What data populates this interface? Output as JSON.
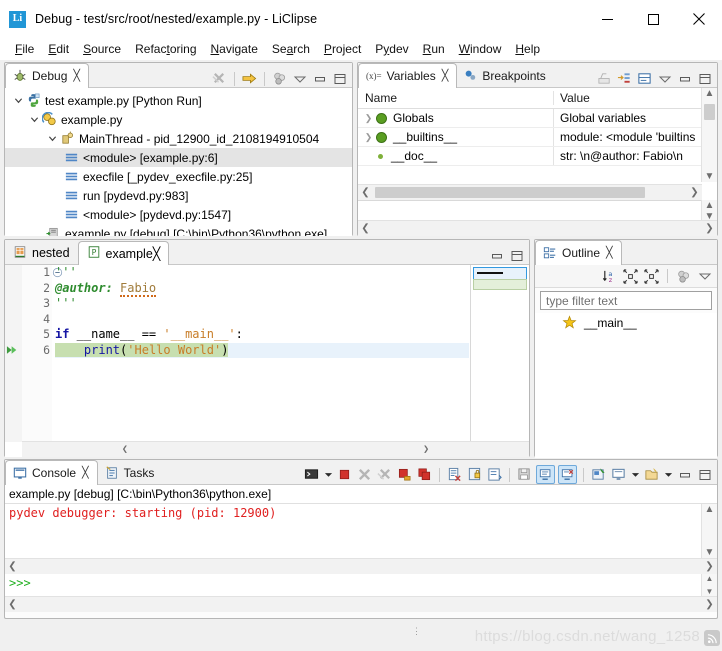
{
  "window": {
    "app_icon": "Li",
    "title": "Debug - test/src/root/nested/example.py - LiClipse",
    "minimize": "minimize-button",
    "maximize": "maximize-button",
    "close": "close-button"
  },
  "menubar": {
    "items": [
      {
        "label": "File",
        "mnemonic": "F"
      },
      {
        "label": "Edit",
        "mnemonic": "E"
      },
      {
        "label": "Source",
        "mnemonic": "S"
      },
      {
        "label": "Refactoring",
        "mnemonic": "t"
      },
      {
        "label": "Navigate",
        "mnemonic": "N"
      },
      {
        "label": "Search",
        "mnemonic": "a"
      },
      {
        "label": "Project",
        "mnemonic": "P"
      },
      {
        "label": "Pydev",
        "mnemonic": "y"
      },
      {
        "label": "Run",
        "mnemonic": "R"
      },
      {
        "label": "Window",
        "mnemonic": "W"
      },
      {
        "label": "Help",
        "mnemonic": "H"
      }
    ]
  },
  "debug_view": {
    "tab_label": "Debug",
    "toolbar": [
      {
        "name": "remove-all-terminated-icon"
      },
      {
        "name": "resume-icon"
      },
      {
        "name": "view-menu-threads-icon"
      },
      {
        "name": "view-menu-icon"
      },
      {
        "name": "minimize-icon"
      },
      {
        "name": "maximize-icon"
      }
    ],
    "tree": [
      {
        "indent": 0,
        "twisty": "expanded",
        "icon": "python-launch-icon",
        "label": "test example.py [Python Run]",
        "selected": false
      },
      {
        "indent": 1,
        "twisty": "expanded",
        "icon": "debug-target-icon",
        "label": "example.py",
        "selected": false
      },
      {
        "indent": 2,
        "twisty": "expanded",
        "icon": "thread-icon",
        "label": "MainThread - pid_12900_id_2108194910504",
        "selected": false
      },
      {
        "indent": 3,
        "twisty": "none",
        "icon": "stack-frame-icon",
        "label": "<module> [example.py:6]",
        "selected": true
      },
      {
        "indent": 3,
        "twisty": "none",
        "icon": "stack-frame-icon",
        "label": "execfile [_pydev_execfile.py:25]",
        "selected": false
      },
      {
        "indent": 3,
        "twisty": "none",
        "icon": "stack-frame-icon",
        "label": "run [pydevd.py:983]",
        "selected": false
      },
      {
        "indent": 3,
        "twisty": "none",
        "icon": "stack-frame-icon",
        "label": "<module> [pydevd.py:1547]",
        "selected": false
      },
      {
        "indent": 2,
        "twisty": "none",
        "icon": "process-icon",
        "label": "example.py [debug] [C:\\bin\\Python36\\python.exe]",
        "selected": false
      }
    ]
  },
  "variables_view": {
    "tabs": [
      {
        "label": "Variables",
        "icon": "variables-icon",
        "active": true
      },
      {
        "label": "Breakpoints",
        "icon": "breakpoints-icon",
        "active": false
      }
    ],
    "toolbar": [
      {
        "name": "show-logical-structure-icon"
      },
      {
        "name": "collapse-all-icon"
      },
      {
        "name": "show-detail-pane-icon"
      },
      {
        "name": "view-menu-icon"
      },
      {
        "name": "minimize-icon"
      },
      {
        "name": "maximize-icon"
      }
    ],
    "columns": [
      "Name",
      "Value"
    ],
    "rows": [
      {
        "expandable": true,
        "bullet": "large",
        "name": "Globals",
        "value": "Global variables"
      },
      {
        "expandable": true,
        "bullet": "large",
        "name": "__builtins__",
        "value": "module: <module 'builtins"
      },
      {
        "expandable": false,
        "bullet": "small",
        "name": "__doc__",
        "value": "str: \\n@author: Fabio\\n"
      }
    ]
  },
  "editor": {
    "tabs": [
      {
        "label": "nested",
        "icon": "project-file-icon",
        "active": false,
        "closable": false
      },
      {
        "label": "example",
        "icon": "python-file-icon",
        "active": true,
        "closable": true
      }
    ],
    "line_numbers": [
      "1",
      "2",
      "3",
      "4",
      "5",
      "6"
    ],
    "code_lines": [
      {
        "n": 1,
        "folding": true,
        "tokens": [
          {
            "t": "'''",
            "c": "docstr"
          }
        ]
      },
      {
        "n": 2,
        "folding": false,
        "tokens": [
          {
            "t": "@author:",
            "c": "docstr-b"
          },
          {
            "t": " ",
            "c": "plain"
          },
          {
            "t": "Fabio",
            "c": "typo"
          }
        ]
      },
      {
        "n": 3,
        "folding": false,
        "tokens": [
          {
            "t": "'''",
            "c": "docstr"
          }
        ]
      },
      {
        "n": 4,
        "folding": false,
        "tokens": []
      },
      {
        "n": 5,
        "folding": false,
        "tokens": [
          {
            "t": "if",
            "c": "kw"
          },
          {
            "t": " __name__ ",
            "c": "plain"
          },
          {
            "t": "==",
            "c": "op"
          },
          {
            "t": " ",
            "c": "plain"
          },
          {
            "t": "'__main__'",
            "c": "str"
          },
          {
            "t": ":",
            "c": "op"
          }
        ]
      },
      {
        "n": 6,
        "folding": false,
        "current": true,
        "tokens": [
          {
            "t": "    ",
            "c": "plain"
          },
          {
            "t": "print",
            "c": "fn"
          },
          {
            "t": "(",
            "c": "op"
          },
          {
            "t": "'Hello World'",
            "c": "str"
          },
          {
            "t": ")",
            "c": "op"
          }
        ]
      }
    ],
    "current_line": 6,
    "breakpoint_arrow_line": 6
  },
  "outline_view": {
    "tab_label": "Outline",
    "toolbar": [
      {
        "name": "sort-alphabetical-icon"
      },
      {
        "name": "collapse-all-icon"
      },
      {
        "name": "expand-all-icon"
      },
      {
        "name": "hide-fields-icon"
      },
      {
        "name": "view-menu-icon"
      }
    ],
    "filter_placeholder": "type filter text",
    "items": [
      {
        "icon": "main-block-icon",
        "label": "__main__"
      }
    ]
  },
  "console_view": {
    "tabs": [
      {
        "label": "Console",
        "icon": "console-icon",
        "active": true
      },
      {
        "label": "Tasks",
        "icon": "tasks-icon",
        "active": false
      }
    ],
    "toolbar": [
      {
        "name": "terminal-icon"
      },
      {
        "name": "terminal-dropdown-icon"
      },
      {
        "name": "terminate-icon"
      },
      {
        "name": "remove-launch-icon"
      },
      {
        "name": "remove-all-launches-icon"
      },
      {
        "name": "terminate-and-remove-icon"
      },
      {
        "name": "terminate-all-icon"
      },
      {
        "name": "clear-console-icon"
      },
      {
        "name": "scroll-lock-icon"
      },
      {
        "name": "word-wrap-icon"
      },
      {
        "name": "save-console-icon"
      },
      {
        "name": "show-console-on-output-icon"
      },
      {
        "name": "show-console-on-error-icon"
      },
      {
        "name": "pin-console-icon"
      },
      {
        "name": "display-selected-console-icon"
      },
      {
        "name": "display-selected-console-dropdown-icon"
      },
      {
        "name": "open-console-icon"
      },
      {
        "name": "open-console-dropdown-icon"
      },
      {
        "name": "minimize-icon"
      },
      {
        "name": "maximize-icon"
      }
    ],
    "process_label": "example.py [debug] [C:\\bin\\Python36\\python.exe]",
    "output_lines": [
      {
        "text": "pydev debugger: starting (pid: 12900)",
        "color": "#e02020"
      }
    ],
    "prompt": ">>>"
  },
  "statusbar": {
    "watermark": "https://blog.csdn.net/wang_1258",
    "grip": "resize-grip"
  },
  "colors": {
    "accent": "#2196d6",
    "selection": "#e4e4e4",
    "current_line": "#e8f2fb",
    "code_highlight": "#c7dfb0",
    "error_text": "#e02020",
    "prompt_green": "#22b022",
    "keyword": "#1515a3",
    "string": "#c87d28",
    "docstring": "#2e8b2e"
  }
}
